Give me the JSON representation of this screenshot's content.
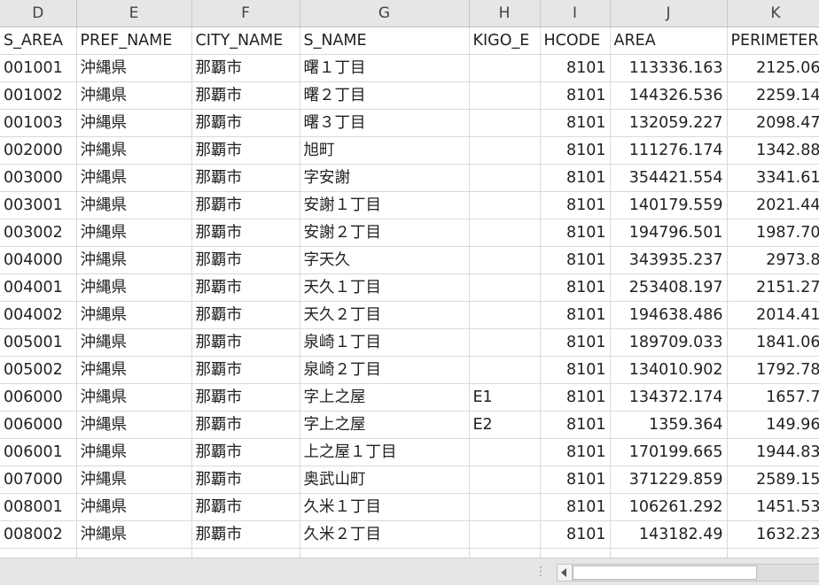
{
  "columns": [
    "D",
    "E",
    "F",
    "G",
    "H",
    "I",
    "J",
    "K"
  ],
  "header_row": [
    "S_AREA",
    "PREF_NAME",
    "CITY_NAME",
    "S_NAME",
    "KIGO_E",
    "HCODE",
    "AREA",
    "PERIMETER"
  ],
  "rows": [
    [
      "001001",
      "沖縄県",
      "那覇市",
      "曙１丁目",
      "",
      "8101",
      "113336.163",
      "2125.06"
    ],
    [
      "001002",
      "沖縄県",
      "那覇市",
      "曙２丁目",
      "",
      "8101",
      "144326.536",
      "2259.14"
    ],
    [
      "001003",
      "沖縄県",
      "那覇市",
      "曙３丁目",
      "",
      "8101",
      "132059.227",
      "2098.47"
    ],
    [
      "002000",
      "沖縄県",
      "那覇市",
      "旭町",
      "",
      "8101",
      "111276.174",
      "1342.88"
    ],
    [
      "003000",
      "沖縄県",
      "那覇市",
      "字安謝",
      "",
      "8101",
      "354421.554",
      "3341.61"
    ],
    [
      "003001",
      "沖縄県",
      "那覇市",
      "安謝１丁目",
      "",
      "8101",
      "140179.559",
      "2021.44"
    ],
    [
      "003002",
      "沖縄県",
      "那覇市",
      "安謝２丁目",
      "",
      "8101",
      "194796.501",
      "1987.70"
    ],
    [
      "004000",
      "沖縄県",
      "那覇市",
      "字天久",
      "",
      "8101",
      "343935.237",
      "2973.8"
    ],
    [
      "004001",
      "沖縄県",
      "那覇市",
      "天久１丁目",
      "",
      "8101",
      "253408.197",
      "2151.27"
    ],
    [
      "004002",
      "沖縄県",
      "那覇市",
      "天久２丁目",
      "",
      "8101",
      "194638.486",
      "2014.41"
    ],
    [
      "005001",
      "沖縄県",
      "那覇市",
      "泉崎１丁目",
      "",
      "8101",
      "189709.033",
      "1841.06"
    ],
    [
      "005002",
      "沖縄県",
      "那覇市",
      "泉崎２丁目",
      "",
      "8101",
      "134010.902",
      "1792.78"
    ],
    [
      "006000",
      "沖縄県",
      "那覇市",
      "字上之屋",
      "E1",
      "8101",
      "134372.174",
      "1657.7"
    ],
    [
      "006000",
      "沖縄県",
      "那覇市",
      "字上之屋",
      "E2",
      "8101",
      "1359.364",
      "149.96"
    ],
    [
      "006001",
      "沖縄県",
      "那覇市",
      "上之屋１丁目",
      "",
      "8101",
      "170199.665",
      "1944.83"
    ],
    [
      "007000",
      "沖縄県",
      "那覇市",
      "奥武山町",
      "",
      "8101",
      "371229.859",
      "2589.15"
    ],
    [
      "008001",
      "沖縄県",
      "那覇市",
      "久米１丁目",
      "",
      "8101",
      "106261.292",
      "1451.53"
    ],
    [
      "008002",
      "沖縄県",
      "那覇市",
      "久米２丁目",
      "",
      "8101",
      "143182.49",
      "1632.23"
    ]
  ],
  "scrollbar": {
    "position_fraction": 0.0
  }
}
